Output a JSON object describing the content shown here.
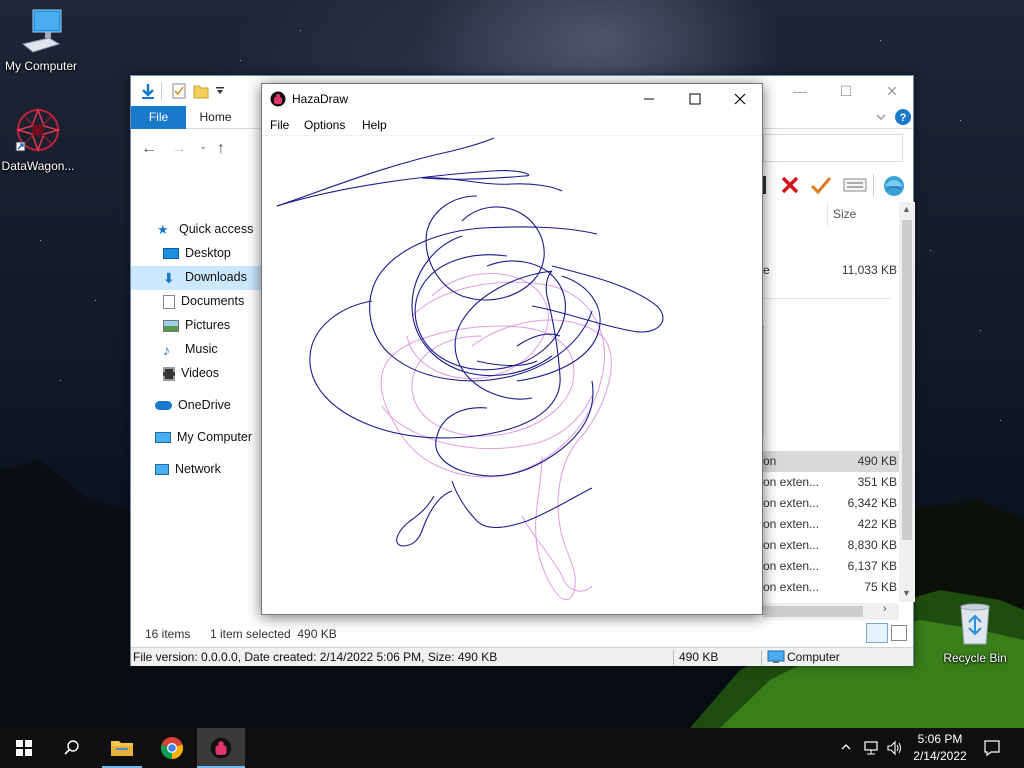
{
  "desktop": {
    "icons": {
      "my_computer": "My Computer",
      "datawagon": "DataWagon...",
      "recycle_bin": "Recycle Bin"
    }
  },
  "explorer": {
    "tabs": {
      "file": "File",
      "home": "Home"
    },
    "nav": {
      "quick_access": "Quick access",
      "desktop": "Desktop",
      "downloads": "Downloads",
      "documents": "Documents",
      "pictures": "Pictures",
      "music": "Music",
      "videos": "Videos",
      "onedrive": "OneDrive",
      "my_computer": "My Computer",
      "network": "Network"
    },
    "column_size": "Size",
    "rows": [
      {
        "name": "e",
        "size": "11,033 KB",
        "selected": false
      },
      {
        "name": "on",
        "size": "490 KB",
        "selected": true
      },
      {
        "name": "on exten...",
        "size": "351 KB",
        "selected": false
      },
      {
        "name": "on exten...",
        "size": "6,342 KB",
        "selected": false
      },
      {
        "name": "on exten...",
        "size": "422 KB",
        "selected": false
      },
      {
        "name": "on exten...",
        "size": "8,830 KB",
        "selected": false
      },
      {
        "name": "on exten...",
        "size": "6,137 KB",
        "selected": false
      },
      {
        "name": "on exten...",
        "size": "75 KB",
        "selected": false
      }
    ],
    "status": {
      "items": "16 items",
      "selected": "1 item selected  490 KB",
      "details": "File version: 0.0.0.0, Date created: 2/14/2022 5:06 PM, Size: 490 KB",
      "size": "490 KB",
      "location": "Computer"
    },
    "colors": {
      "accent": "#1979ca",
      "selection": "#cce8ff"
    }
  },
  "hazadraw": {
    "title": "HazaDraw",
    "menu": {
      "file": "File",
      "options": "Options",
      "help": "Help"
    },
    "stroke_colors": {
      "primary": "#1a1a8c",
      "secondary": "#e29be3"
    }
  },
  "taskbar": {
    "time": "5:06 PM",
    "date": "2/14/2022",
    "pinned": [
      "windows-start",
      "search",
      "file-explorer",
      "chrome",
      "hazadraw"
    ]
  }
}
